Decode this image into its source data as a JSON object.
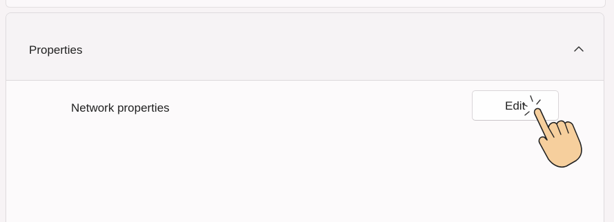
{
  "section": {
    "title": "Properties",
    "chevron_icon": "chevron-up-icon",
    "expanded": true
  },
  "row": {
    "label": "Network properties",
    "button_label": "Edit"
  },
  "cursor": {
    "icon": "hand-pointer-click-icon"
  },
  "colors": {
    "background": "#f7f3f5",
    "card": "#fcfafb",
    "header": "#f6f3f5",
    "border": "#dedadd",
    "text": "#1f1f1f",
    "hand_fill": "#f6cf9d"
  }
}
